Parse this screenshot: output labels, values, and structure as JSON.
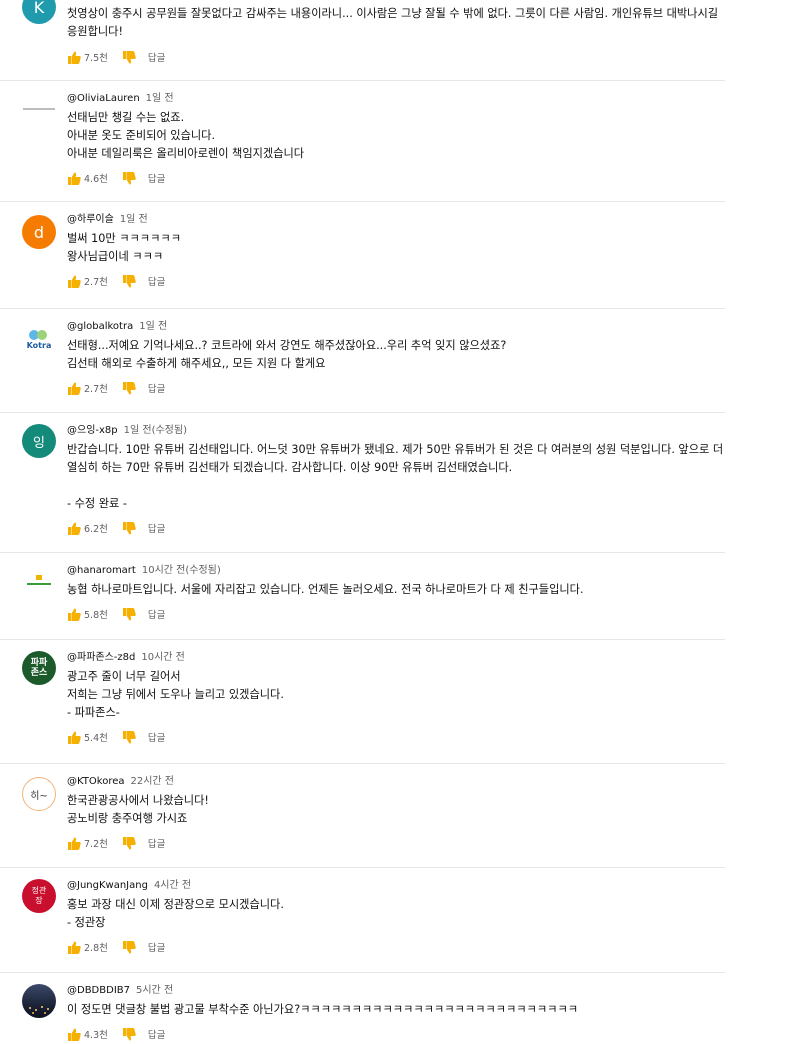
{
  "colors": {
    "thumb": "#f5b000",
    "divider": "#e6e6e6",
    "meta": "#606060"
  },
  "comments": [
    {
      "author": "",
      "time": "",
      "text": "첫영상이 충주시 공무원들 잘못없다고 감싸주는 내용이라니... 이사람은 그냥 잘될 수 밖에 없다. 그릇이 다른 사람임. 개인유튜브 대박나시길\n응원합니다!",
      "likes": "7.5천",
      "reply": "답글",
      "avatar": {
        "letter": "K",
        "bg": "#1f9bad",
        "fg": "#ffffff"
      }
    },
    {
      "author": "@OliviaLauren",
      "time": "1일 전",
      "text": "선태님만 챙길 수는 없죠.\n아내분 옷도 준비되어 있습니다.\n아내분 데일리룩은 올리비아로렌이 책임지겠습니다",
      "likes": "4.6천",
      "reply": "답글",
      "avatar": {
        "letter": "",
        "bg": "#ffffff",
        "fg": "#999999"
      }
    },
    {
      "author": "@하루이슬",
      "time": "1일 전",
      "text": "벌써 10만 ㅋㅋㅋㅋㅋㅋ\n왕사님급이네 ㅋㅋㅋ",
      "likes": "2.7천",
      "reply": "답글",
      "avatar": {
        "letter": "d",
        "bg": "#f57c00",
        "fg": "#ffffff"
      }
    },
    {
      "author": "@globalkotra",
      "time": "1일 전",
      "text": "선태형...저예요 기억나세요..? 코트라에 와서 강연도 해주셨잖아요...우리 추억 잊지 않으셨죠?\n김선태 해외로 수출하게 해주세요,, 모든 지원 다 할게요",
      "likes": "2.7천",
      "reply": "답글",
      "avatar": {
        "letter": "Kotra",
        "bg": "#ffffff",
        "fg": "#1b5aa6"
      }
    },
    {
      "author": "@으잉-x8p",
      "time": "1일 전(수정됨)",
      "text": "반갑습니다. 10만 유튜버 김선태입니다. 어느덧 30만 유튜버가 됐네요. 제가 50만 유튜버가 된 것은 다 여러분의 성원 덕분입니다. 앞으로 더\n열심히 하는 70만 유튜버 김선태가 되겠습니다. 감사합니다. 이상 90만 유튜버 김선태였습니다.\n\n- 수정 완료 -",
      "likes": "6.2천",
      "reply": "답글",
      "avatar": {
        "letter": "잉",
        "bg": "#138a7a",
        "fg": "#ffffff"
      }
    },
    {
      "author": "@hanaromart",
      "time": "10시간 전(수정됨)",
      "text": "농협 하나로마트입니다. 서울에 자리잡고 있습니다. 언제든 놀러오세요. 전국 하나로마트가 다 제 친구들입니다.",
      "likes": "5.8천",
      "reply": "답글",
      "avatar": {
        "letter": "",
        "bg": "#ffffff",
        "fg": "#3a9b3a"
      }
    },
    {
      "author": "@파파존스-z8d",
      "time": "10시간 전",
      "text": "광고주 줄이 너무 길어서\n저희는 그냥 뒤에서 도우나 늘리고 있겠습니다.\n- 파파존스-",
      "likes": "5.4천",
      "reply": "답글",
      "avatar": {
        "letter": "파파\n존스",
        "bg": "#1c5a2c",
        "fg": "#ffffff"
      }
    },
    {
      "author": "@KTOkorea",
      "time": "22시간 전",
      "text": "한국관광공사에서 나왔습니다!\n공노비랑 충주여행 가시죠",
      "likes": "7.2천",
      "reply": "답글",
      "avatar": {
        "letter": "히~",
        "bg": "#ffffff",
        "fg": "#333333"
      }
    },
    {
      "author": "@JungKwanJang",
      "time": "4시간 전",
      "text": "홍보 과장 대신 이제 정관장으로 모시겠습니다.\n- 정관장",
      "likes": "2.8천",
      "reply": "답글",
      "avatar": {
        "letter": "정관\n장",
        "bg": "#c8102e",
        "fg": "#ffffff"
      }
    },
    {
      "author": "@DBDBDIB7",
      "time": "5시간 전",
      "text": "이 정도면 댓글창 불법 광고물 부착수준 아닌가요?ㅋㅋㅋㅋㅋㅋㅋㅋㅋㅋㅋㅋㅋㅋㅋㅋㅋㅋㅋㅋㅋㅋㅋㅋㅋㅋㅋ",
      "likes": "4.3천",
      "reply": "답글",
      "avatar": {
        "letter": "",
        "bg": "#2b3550",
        "fg": "#ffffff"
      }
    }
  ]
}
